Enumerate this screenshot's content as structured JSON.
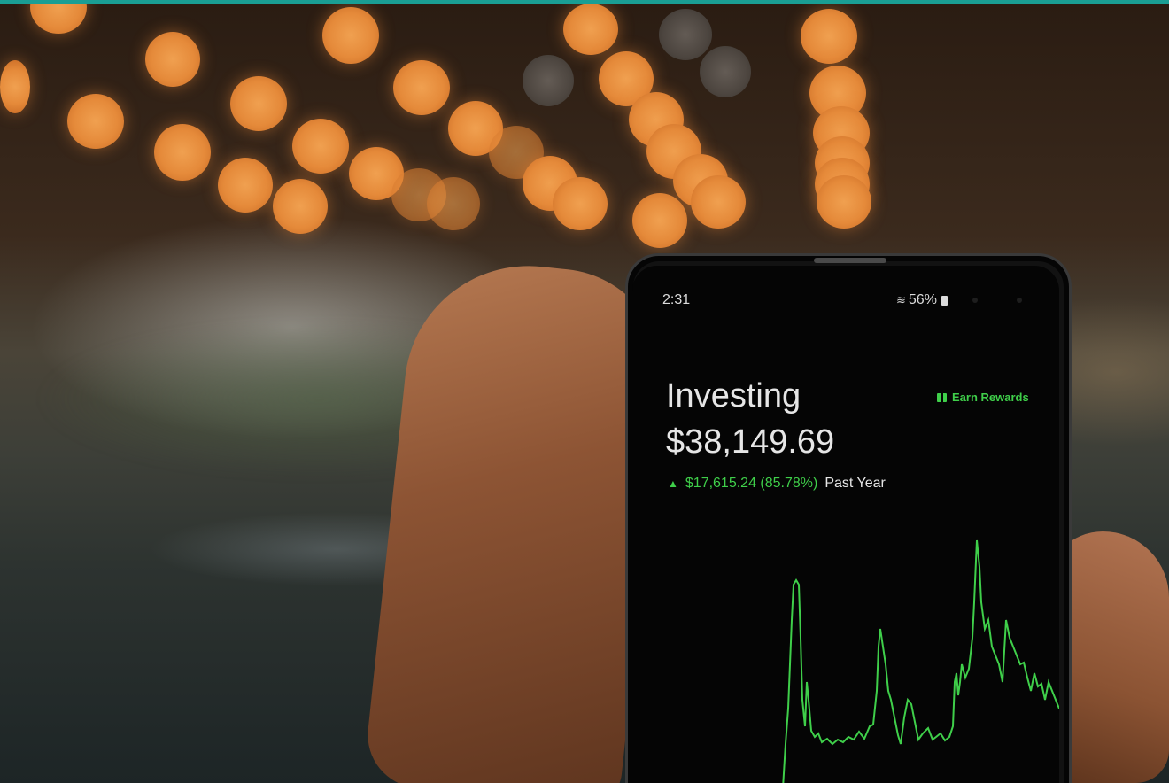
{
  "phone": {
    "status": {
      "time": "2:31",
      "battery": "56%"
    },
    "title": "Investing",
    "balance": "$38,149.69",
    "rewards_label": "Earn Rewards",
    "change": {
      "value": "$17,615.24 (85.78%)",
      "period": "Past Year"
    }
  },
  "colors": {
    "accent_green": "#3fcf4a",
    "top_bar": "#1a9e94"
  }
}
